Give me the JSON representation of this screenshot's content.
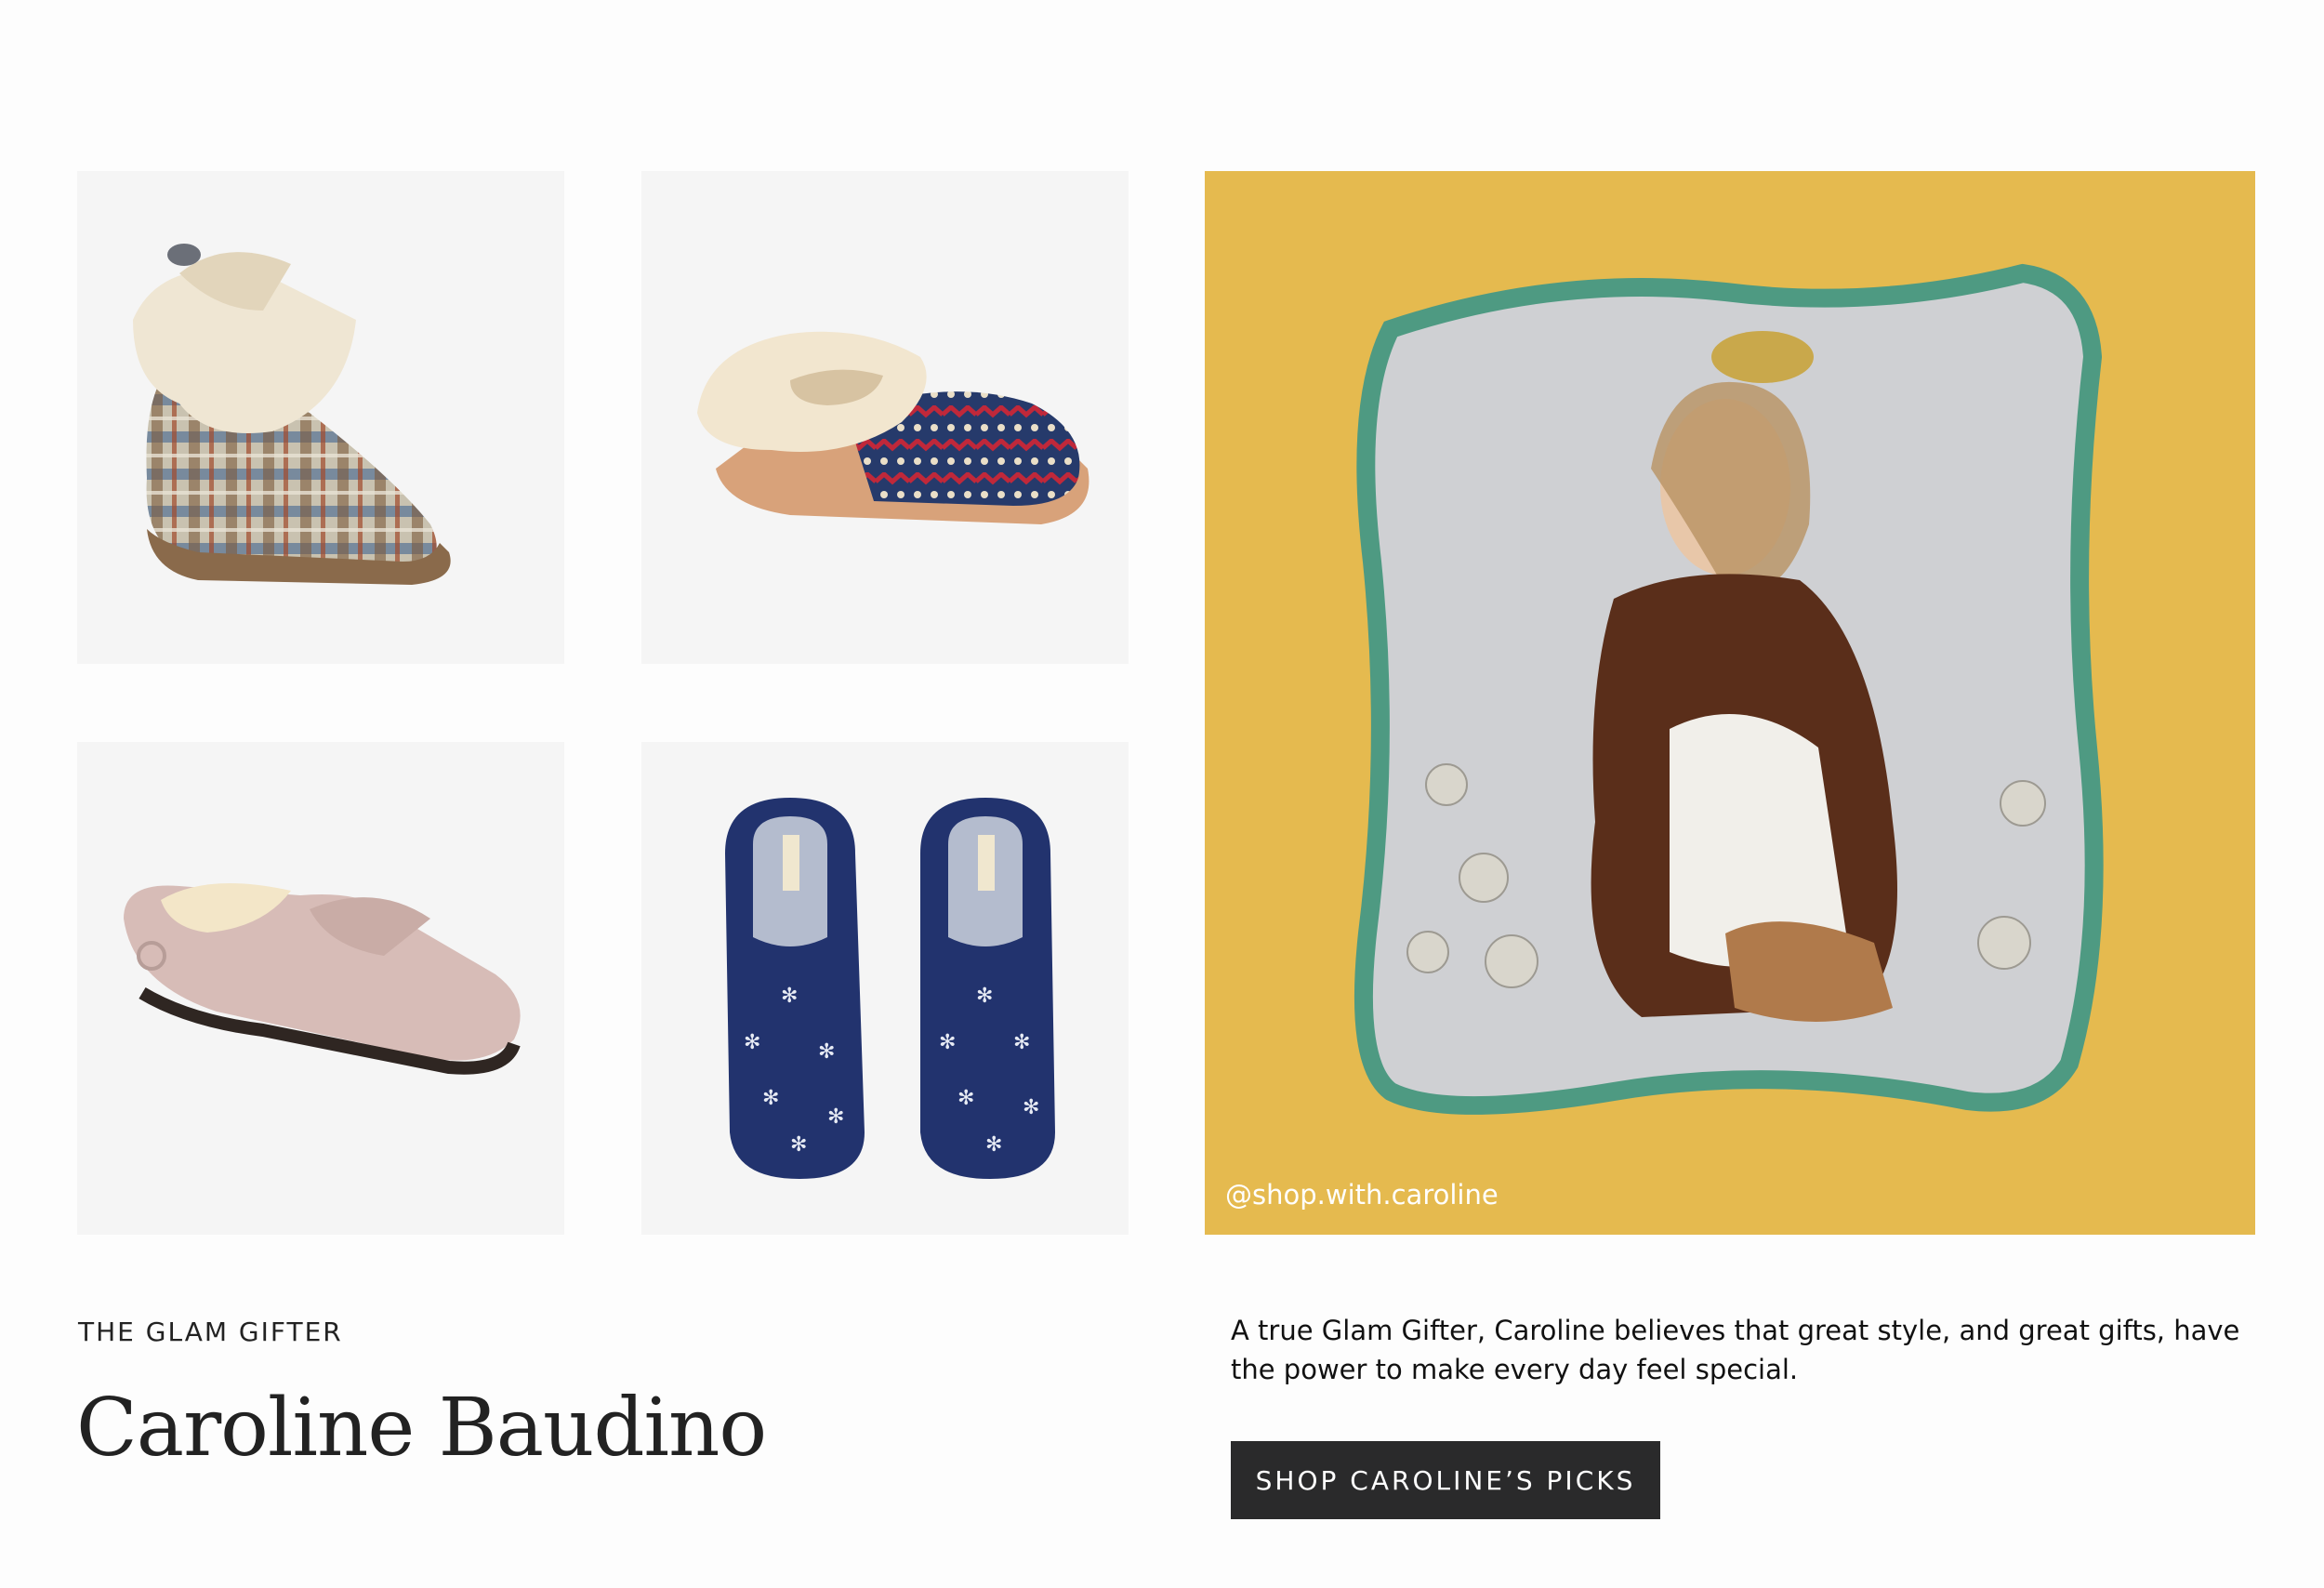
{
  "products": [
    {
      "name": "plaid-bootie-slipper"
    },
    {
      "name": "fair-isle-knit-slipper"
    },
    {
      "name": "pink-suede-moccasin"
    },
    {
      "name": "navy-snowflake-scuff-slippers"
    }
  ],
  "hero": {
    "handle": "@shop.with.caroline",
    "background": "#e5ba4f",
    "frame_color": "#4e9a82"
  },
  "profile": {
    "eyebrow": "THE GLAM GIFTER",
    "name": "Caroline Baudino",
    "description": "A true Glam Gifter, Caroline believes that great style, and great gifts, have the power to make every day feel special.",
    "cta_label": "SHOP CAROLINE’S PICKS"
  }
}
